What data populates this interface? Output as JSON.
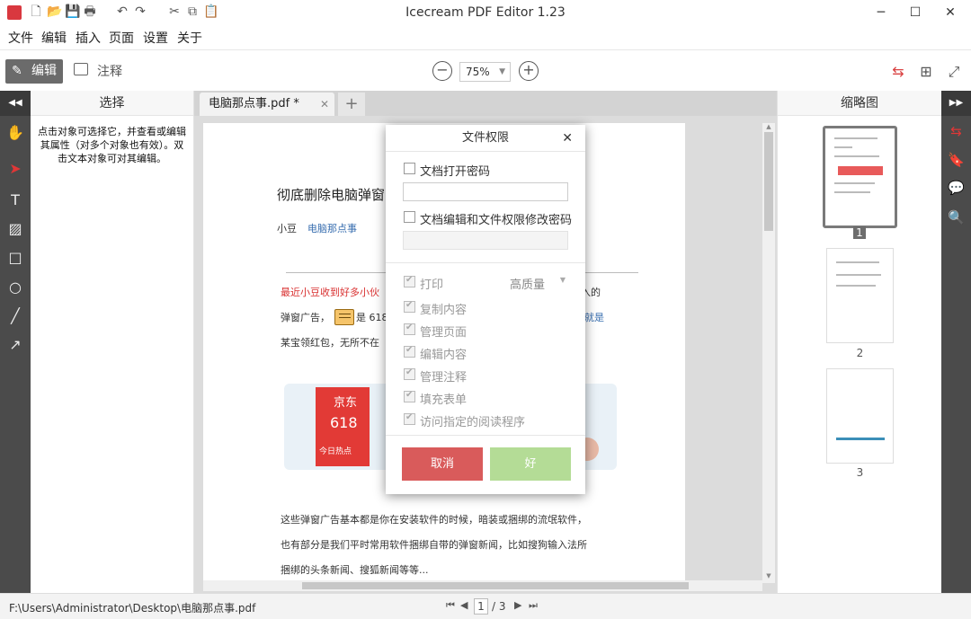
{
  "app": {
    "title": "Icecream PDF Editor 1.23"
  },
  "menu": [
    "文件",
    "编辑",
    "插入",
    "页面",
    "设置",
    "关于"
  ],
  "toolbar": {
    "edit_label": "编辑",
    "annotate_label": "注释",
    "zoom": "75%"
  },
  "left_panel": {
    "title": "选择",
    "description": "点击对象可选择它，并查看或编辑其属性（对多个对象也有效）。双击文本对象可对其编辑。"
  },
  "tab": {
    "name": "电脑那点事.pdf *"
  },
  "document": {
    "heading": "彻底删除电脑弹窗",
    "author": "小豆",
    "source": "电脑那点事",
    "para1_red": "最近小豆收到好多小伙",
    "para1_tail": "入的",
    "para2a": "弹窗广告，",
    "para2b": "是 618",
    "para2_blue": "就是",
    "para3": "某宝领红包，无所不在",
    "banner_brand": "京东",
    "banner_618": "618",
    "banner_sub": "今日热点",
    "para4": "这些弹窗广告基本都是你在安装软件的时候，暗装或捆绑的流氓软件，",
    "para5": "也有部分是我们平时常用软件捆绑自带的弹窗新闻，比如搜狗输入法所",
    "para6": "捆绑的头条新闻、搜狐新闻等等..."
  },
  "thumbnails": {
    "title": "缩略图",
    "pages": [
      "1",
      "2",
      "3"
    ]
  },
  "status": {
    "path": "F:\\Users\\Administrator\\Desktop\\电脑那点事.pdf",
    "page": "1",
    "total": "/ 3"
  },
  "dialog": {
    "title": "文件权限",
    "open_password": "文档打开密码",
    "edit_password": "文档编辑和文件权限修改密码",
    "print": "打印",
    "print_quality": "高质量",
    "copy": "复制内容",
    "manage_pages": "管理页面",
    "edit_content": "编辑内容",
    "manage_annotations": "管理注释",
    "fill_forms": "填充表单",
    "reader_access": "访问指定的阅读程序",
    "cancel": "取消",
    "ok": "好"
  },
  "colors": {
    "accent_red": "#d95b5b",
    "ok_green": "#b4dc96",
    "rail_dark": "#4b4b4b",
    "link_blue": "#3a6fb0"
  }
}
